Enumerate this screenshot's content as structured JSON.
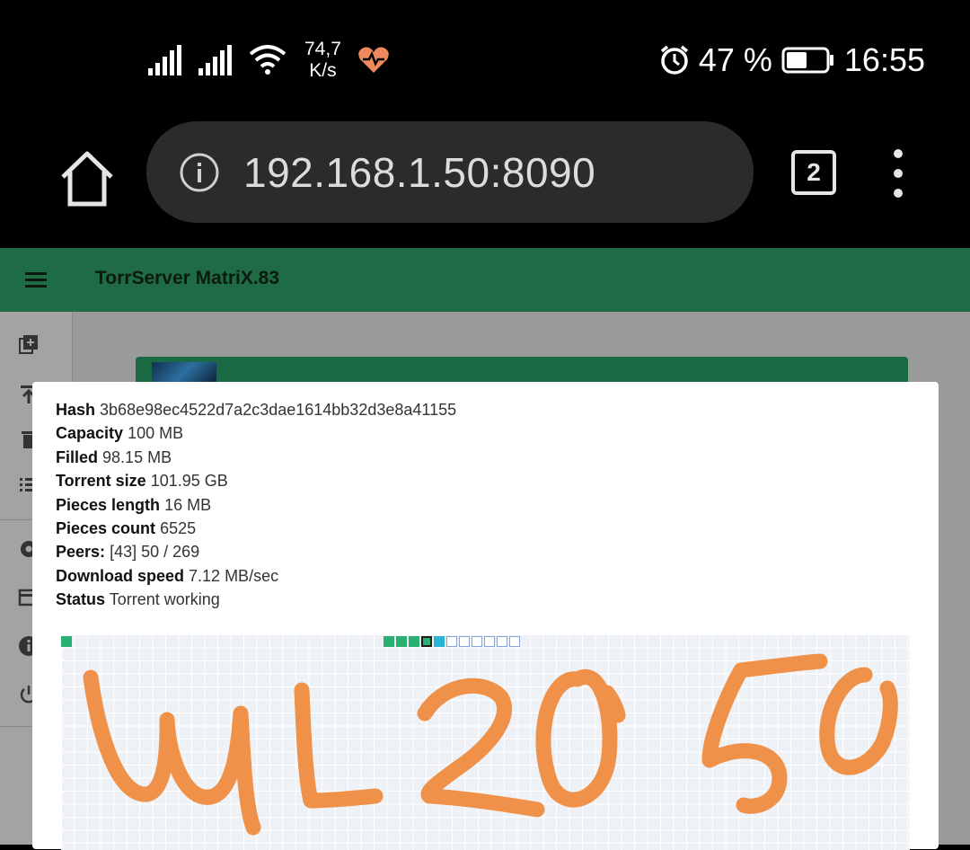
{
  "status_bar": {
    "net_speed_value": "74,7",
    "net_speed_unit": "K/s",
    "battery": "47 %",
    "time": "16:55"
  },
  "browser": {
    "url": "192.168.1.50:8090",
    "tab_count": "2"
  },
  "app": {
    "title": "TorrServer MatriX.83"
  },
  "torrent_info": {
    "hash_label": "Hash",
    "hash": "3b68e98ec4522d7a2c3dae1614bb32d3e8a41155",
    "capacity_label": "Capacity",
    "capacity": "100 MB",
    "filled_label": "Filled",
    "filled": "98.15 MB",
    "torrent_size_label": "Torrent size",
    "torrent_size": "101.95 GB",
    "pieces_length_label": "Pieces length",
    "pieces_length": "16 MB",
    "pieces_count_label": "Pieces count",
    "pieces_count": "6525",
    "peers_label": "Peers:",
    "peers": "[43] 50 / 269",
    "download_speed_label": "Download speed",
    "download_speed": "7.12 MB/sec",
    "status_label": "Status",
    "status": "Torrent working"
  },
  "colors": {
    "appbar": "#1f6b45",
    "piece_done": "#2bb074",
    "piece_current": "#29b6d6",
    "scribble": "#f0914a"
  }
}
